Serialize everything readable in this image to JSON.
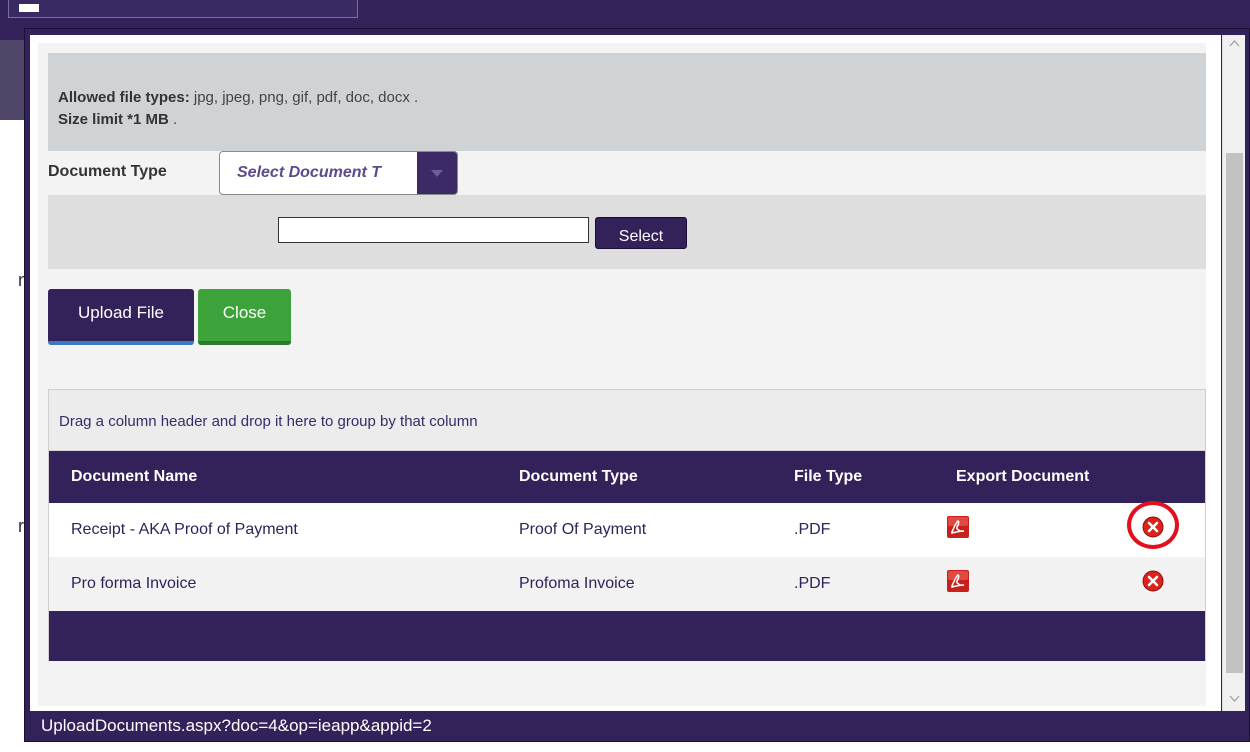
{
  "notice": {
    "allowed_label": "Allowed file types:",
    "allowed_value": "jpg, jpeg, png, gif, pdf, doc, docx .",
    "size_label": "Size limit *1 MB",
    "size_suffix": "."
  },
  "document_type": {
    "label": "Document Type",
    "selected": "Select Document T"
  },
  "file_picker": {
    "value": "",
    "select_label": "Select"
  },
  "buttons": {
    "upload": "Upload File",
    "close": "Close"
  },
  "grid": {
    "group_hint": "Drag a column header and drop it here to group by that column",
    "columns": [
      "Document Name",
      "Document Type",
      "File Type",
      "Export Document"
    ],
    "rows": [
      {
        "name": "Receipt - AKA Proof of Payment",
        "type": "Proof Of Payment",
        "file_type": ".PDF"
      },
      {
        "name": "Pro forma Invoice",
        "type": "Profoma Invoice",
        "file_type": ".PDF"
      }
    ]
  },
  "status_url": "UploadDocuments.aspx?doc=4&op=ieapp&appid=2",
  "colors": {
    "brand_purple": "#33215a",
    "close_green": "#3da23a",
    "pdf_red": "#c8201b",
    "delete_red": "#d9231c",
    "highlight_red": "#e1101e"
  },
  "icons": [
    "pdf-icon",
    "delete-icon",
    "chevron-down-icon",
    "chevron-up-icon"
  ]
}
